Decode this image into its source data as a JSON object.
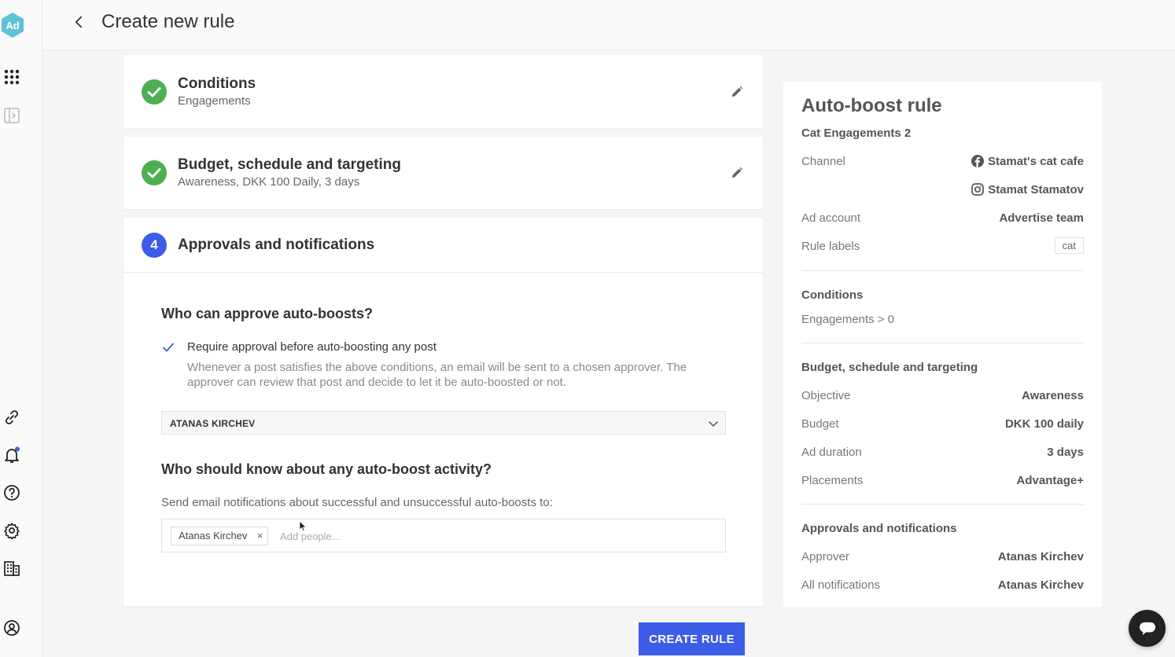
{
  "app": {
    "logo_text": "Ad",
    "brand_color": "#5ec3d8",
    "accent_color": "#3d5ce8",
    "success_color": "#4caf50"
  },
  "header": {
    "title": "Create new rule"
  },
  "steps": {
    "conditions": {
      "title": "Conditions",
      "subtitle": "Engagements"
    },
    "budget": {
      "title": "Budget, schedule and targeting",
      "subtitle": "Awareness, DKK 100 Daily, 3 days"
    },
    "approvals": {
      "number": "4",
      "title": "Approvals and notifications",
      "approve_heading": "Who can approve auto-boosts?",
      "require_label": "Require approval before auto-boosting any post",
      "require_checked": true,
      "require_help": "Whenever a post satisfies the above conditions, an email will be sent to a chosen approver. The approver can review that post and decide to let it be auto-boosted or not.",
      "approver_value": "ATANAS KIRCHEV",
      "notify_heading": "Who should know about any auto-boost activity?",
      "notify_help": "Send email notifications about successful and unsuccessful auto-boosts to:",
      "people": [
        "Atanas Kirchev"
      ],
      "people_remove_glyph": "×",
      "people_placeholder": "Add people..."
    }
  },
  "actions": {
    "create_label": "CREATE RULE"
  },
  "summary": {
    "title": "Auto-boost rule",
    "rule_name": "Cat Engagements 2",
    "channel_label": "Channel",
    "channels": [
      {
        "icon": "facebook-icon",
        "name": "Stamat's cat cafe"
      },
      {
        "icon": "instagram-icon",
        "name": "Stamat Stamatov"
      }
    ],
    "ad_account_label": "Ad account",
    "ad_account_value": "Advertise team",
    "rule_labels_label": "Rule labels",
    "rule_labels_value": "cat",
    "conditions_heading": "Conditions",
    "conditions_value": "Engagements > 0",
    "budget_heading": "Budget, schedule and targeting",
    "objective_label": "Objective",
    "objective_value": "Awareness",
    "budget_label": "Budget",
    "budget_value": "DKK 100 daily",
    "duration_label": "Ad duration",
    "duration_value": "3 days",
    "placements_label": "Placements",
    "placements_value": "Advantage+",
    "approvals_heading": "Approvals and notifications",
    "approver_label": "Approver",
    "approver_value": "Atanas Kirchev",
    "notifications_label": "All notifications",
    "notifications_value": "Atanas Kirchev"
  },
  "nav": {
    "top": [
      "apps-grid-icon",
      "sidebar-toggle-icon"
    ],
    "bottom": [
      "link-icon",
      "bell-icon",
      "help-icon",
      "gear-icon",
      "building-icon",
      "profile-icon"
    ]
  }
}
